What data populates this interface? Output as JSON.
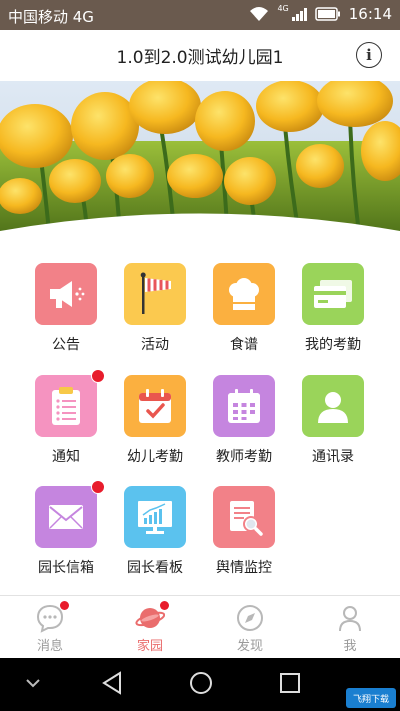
{
  "status_bar": {
    "carrier": "中国移动 4G",
    "time": "16:14",
    "signal_label": "4G"
  },
  "header": {
    "title": "1.0到2.0测试幼儿园1",
    "info_icon": "info-circle-icon"
  },
  "banner": {
    "icon": "tulip-photo"
  },
  "grid": {
    "items": [
      {
        "label": "公告",
        "icon": "megaphone-icon",
        "color": "#f28188",
        "badge": false
      },
      {
        "label": "活动",
        "icon": "flag-icon",
        "color": "#fbc94f",
        "badge": false
      },
      {
        "label": "食谱",
        "icon": "chef-hat-icon",
        "color": "#fbb040",
        "badge": false
      },
      {
        "label": "我的考勤",
        "icon": "card-icon",
        "color": "#9ad45a",
        "badge": false
      },
      {
        "label": "通知",
        "icon": "clipboard-icon",
        "color": "#f593c0",
        "badge": true
      },
      {
        "label": "幼儿考勤",
        "icon": "calendar-check-icon",
        "color": "#fbb040",
        "badge": false
      },
      {
        "label": "教师考勤",
        "icon": "calendar-grid-icon",
        "color": "#c585df",
        "badge": false
      },
      {
        "label": "通讯录",
        "icon": "contact-icon",
        "color": "#9ad45a",
        "badge": false
      },
      {
        "label": "园长信箱",
        "icon": "mail-icon",
        "color": "#c585df",
        "badge": true
      },
      {
        "label": "园长看板",
        "icon": "board-chart-icon",
        "color": "#5bc2ee",
        "badge": false
      },
      {
        "label": "舆情监控",
        "icon": "document-search-icon",
        "color": "#f28188",
        "badge": false
      }
    ]
  },
  "tabs": [
    {
      "label": "消息",
      "icon": "chat-bubble-icon",
      "active": false,
      "dot": true
    },
    {
      "label": "家园",
      "icon": "planet-icon",
      "active": true,
      "dot": true
    },
    {
      "label": "发现",
      "icon": "compass-icon",
      "active": false,
      "dot": false
    },
    {
      "label": "我",
      "icon": "person-icon",
      "active": false,
      "dot": false
    }
  ],
  "nav": {
    "watermark": "飞翔下载"
  }
}
